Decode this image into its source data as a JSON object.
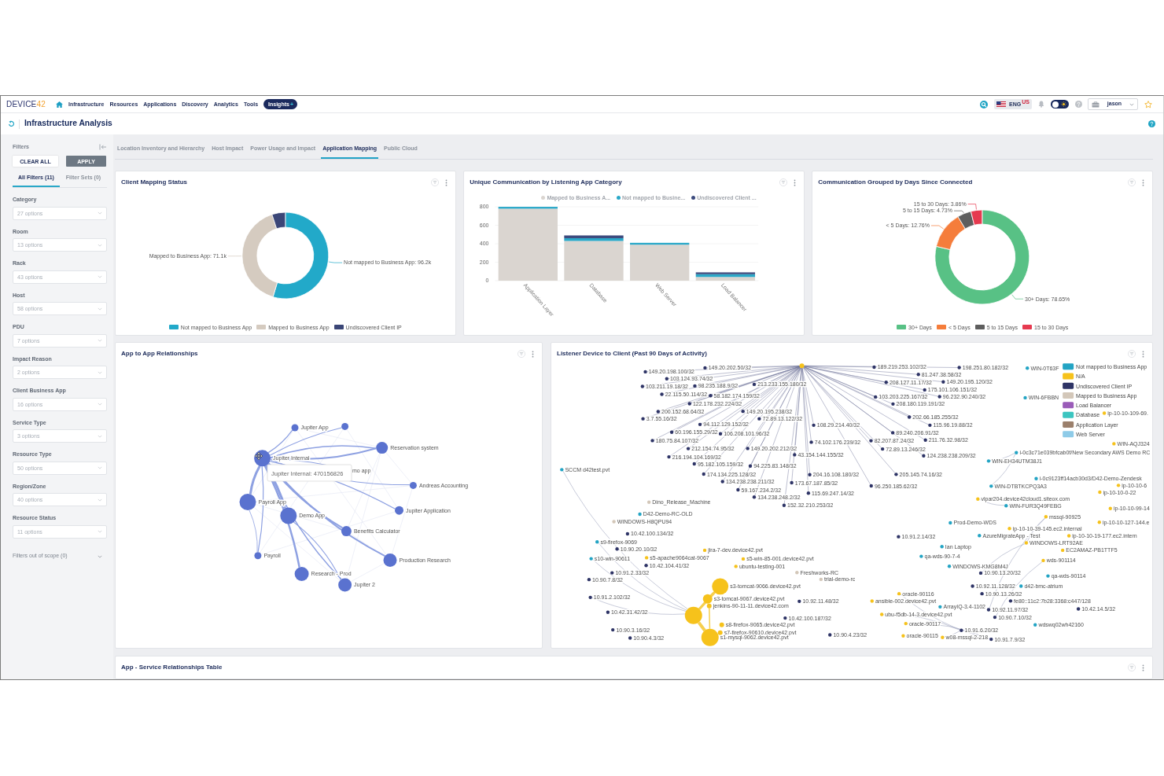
{
  "navbar": {
    "logo": {
      "text": "DEVICE",
      "number": "42"
    },
    "menu": [
      "Infrastructure",
      "Resources",
      "Applications",
      "Discovery",
      "Analytics",
      "Tools"
    ],
    "insights": {
      "label": "Insights",
      "badge": "+"
    },
    "language": {
      "code": "ENG",
      "region": "US"
    },
    "theme_toggle": {
      "on": false
    },
    "user": {
      "name": "jason"
    }
  },
  "page_title": "Infrastructure Analysis",
  "filters": {
    "title": "Filters",
    "clear_button": "CLEAR ALL",
    "apply_button": "APPLY",
    "tabs": [
      {
        "label": "All Filters (11)",
        "selected": true
      },
      {
        "label": "Filter Sets (0)",
        "selected": false
      }
    ],
    "groups": [
      {
        "label": "Category",
        "placeholder": "27 options"
      },
      {
        "label": "Room",
        "placeholder": "13 options"
      },
      {
        "label": "Rack",
        "placeholder": "43 options"
      },
      {
        "label": "Host",
        "placeholder": "58 options"
      },
      {
        "label": "PDU",
        "placeholder": "7 options"
      },
      {
        "label": "Impact Reason",
        "placeholder": "2 options"
      },
      {
        "label": "Client Business App",
        "placeholder": "16 options"
      },
      {
        "label": "Service Type",
        "placeholder": "3 options"
      },
      {
        "label": "Resource Type",
        "placeholder": "50 options"
      },
      {
        "label": "Region/Zone",
        "placeholder": "40 options"
      },
      {
        "label": "Resource Status",
        "placeholder": "11 options"
      }
    ],
    "out_of_scope": "Filters out of scope (0)"
  },
  "tabs": [
    {
      "label": "Location Inventory and Hierarchy",
      "selected": false
    },
    {
      "label": "Host Impact",
      "selected": false
    },
    {
      "label": "Power Usage and Impact",
      "selected": false
    },
    {
      "label": "Application Mapping",
      "selected": true
    },
    {
      "label": "Public Cloud",
      "selected": false
    }
  ],
  "client_mapping": {
    "title": "Client Mapping Status",
    "chart_data": {
      "type": "donut",
      "legend": "bottom",
      "categories": [
        "Not mapped to Business App",
        "Mapped to Business App",
        "Undiscovered Client IP"
      ],
      "values": [
        96.2,
        71.1,
        8.8
      ],
      "colors": [
        "#22a9c9",
        "#d5cbc0",
        "#3b4677"
      ],
      "value_labels": [
        "Not mapped to Business App: 96.2k",
        "Mapped to Business App: 71.1k",
        null
      ]
    }
  },
  "unique_communication": {
    "title": "Unique Communication by Listening App Category",
    "chart_data": {
      "type": "bar",
      "legend": "top",
      "stacked": true,
      "grid": true,
      "categories": [
        "Application Layer",
        "Database",
        "Web Server",
        "Load Balancer"
      ],
      "series": [
        {
          "name": "Mapped to Business A...",
          "color": "#dad5d0",
          "values": [
            780,
            430,
            390,
            40
          ]
        },
        {
          "name": "Not mapped to Busine...",
          "color": "#2aa8c8",
          "values": [
            20,
            30,
            20,
            30
          ]
        },
        {
          "name": "Undiscovered Client ...",
          "color": "#3d4b7e",
          "values": [
            0,
            30,
            0,
            20
          ]
        }
      ],
      "ylim": [
        0,
        800
      ],
      "yticks": [
        0,
        200,
        400,
        600,
        800
      ]
    }
  },
  "days_since_connected": {
    "title": "Communication Grouped by Days Since Connected",
    "chart_data": {
      "type": "donut",
      "legend": "bottom",
      "categories": [
        "30+ Days",
        "< 5 Days",
        "5 to 15 Days",
        "15 to 30 Days"
      ],
      "values": [
        78.65,
        12.76,
        4.73,
        3.86
      ],
      "colors": [
        "#58c185",
        "#f57d3b",
        "#5e5e5e",
        "#e63a50"
      ],
      "value_labels": [
        "30+ Days: 78.65%",
        "< 5 Days: 12.76%",
        "5 to 15 Days: 4.73%",
        "15 to 30 Days: 3.86%"
      ]
    }
  },
  "app_relationships": {
    "title": "App to App Relationships",
    "nodes": [
      {
        "kind": "node",
        "label": "Jupiter Internal"
      },
      {
        "kind": "node",
        "label": "Jupiter App"
      },
      {
        "kind": "node"
      },
      {
        "kind": "node",
        "label": "Reservation system"
      },
      {
        "kind": "covered",
        "label": "mo app"
      },
      {
        "kind": "node",
        "label": "Andreas Accounting"
      },
      {
        "kind": "node",
        "label": "Jupiter Application"
      },
      {
        "kind": "node",
        "label": "Payroll App"
      },
      {
        "kind": "node",
        "label": "Demo App"
      },
      {
        "kind": "node",
        "label": "Benefits Calculator"
      },
      {
        "kind": "node",
        "label": "Payroll"
      },
      {
        "kind": "node",
        "label": "Production Research"
      },
      {
        "kind": "node",
        "label": "Research - Prod"
      },
      {
        "kind": "node",
        "label": "Jupiter 2"
      }
    ],
    "tooltip": "Jupiter Internal: 470156826"
  },
  "listener_graph": {
    "title": "Listener Device to Client (Past 90 Days of Activity)",
    "legend": [
      {
        "label": "Not mapped to Business App",
        "color": "#23a4c4"
      },
      {
        "label": "N/A",
        "color": "#f6c21b"
      },
      {
        "label": "Undiscovered Client IP",
        "color": "#2e3466"
      },
      {
        "label": "Mapped to Business App",
        "color": "#d3c7b9"
      },
      {
        "label": "Load Balancer",
        "color": "#9a5cb8"
      },
      {
        "label": "Database",
        "color": "#3cc5c0"
      },
      {
        "label": "Application Layer",
        "color": "#9b806c"
      },
      {
        "label": "Web Server",
        "color": "#8ecbe8"
      }
    ],
    "nodes": [
      {
        "color": "#f6c21b"
      },
      {
        "label": "149.20.198.100/32",
        "color": "#2e3466"
      },
      {
        "label": "149.20.202.50/32",
        "color": "#2e3466"
      },
      {
        "label": "103.124.93.74/32",
        "color": "#2e3466"
      },
      {
        "label": "103.211.19.18/32",
        "color": "#2e3466"
      },
      {
        "label": "98.235.188.9/32",
        "color": "#2e3466"
      },
      {
        "label": "213.233.155.180/32",
        "color": "#2e3466"
      },
      {
        "label": "22.115.50.114/32",
        "color": "#2e3466"
      },
      {
        "label": "58.182.174.159/32",
        "color": "#2e3466"
      },
      {
        "label": "122.178.232.224/32",
        "color": "#2e3466"
      },
      {
        "label": "200.152.68.64/32",
        "color": "#2e3466"
      },
      {
        "label": "3.7.55.16/32",
        "color": "#2e3466"
      },
      {
        "label": "149.20.195.238/32",
        "color": "#2e3466"
      },
      {
        "label": "72.89.13.122/32",
        "color": "#2e3466"
      },
      {
        "label": "94.112.129.152/32",
        "color": "#2e3466"
      },
      {
        "label": "108.29.214.40/32",
        "color": "#2e3466"
      },
      {
        "label": "60.196.155.29/32",
        "color": "#2e3466"
      },
      {
        "label": "106.208.101.96/32",
        "color": "#2e3466"
      },
      {
        "label": "180.75.84.107/32",
        "color": "#2e3466"
      },
      {
        "label": "212.154.74.95/32",
        "color": "#2e3466"
      },
      {
        "label": "74.102.176.239/32",
        "color": "#2e3466"
      },
      {
        "label": "149.20.202.212/32",
        "color": "#2e3466"
      },
      {
        "label": "216.194.104.169/32",
        "color": "#2e3466"
      },
      {
        "label": "43.154.144.155/32",
        "color": "#2e3466"
      },
      {
        "label": "95.182.105.159/32",
        "color": "#2e3466"
      },
      {
        "label": "94.225.83.148/32",
        "color": "#2e3466"
      },
      {
        "label": "174.134.225.128/32",
        "color": "#2e3466"
      },
      {
        "label": "204.16.108.180/32",
        "color": "#2e3466"
      },
      {
        "label": "134.238.238.211/32",
        "color": "#2e3466"
      },
      {
        "label": "173.67.187.85/32",
        "color": "#2e3466"
      },
      {
        "label": "59.167.234.2/32",
        "color": "#2e3466"
      },
      {
        "label": "134.238.248.2/32",
        "color": "#2e3466"
      },
      {
        "label": "115.69.247.14/32",
        "color": "#2e3466"
      },
      {
        "label": "152.32.210.253/32",
        "color": "#2e3466"
      },
      {
        "label": "189.219.253.102/32",
        "color": "#2e3466"
      },
      {
        "label": "81.247.38.58/32",
        "color": "#2e3466"
      },
      {
        "label": "198.251.80.182/32",
        "color": "#2e3466"
      },
      {
        "label": "208.127.11.17/32",
        "color": "#2e3466"
      },
      {
        "label": "149.20.195.120/32",
        "color": "#2e3466"
      },
      {
        "label": "175.101.106.151/32",
        "color": "#2e3466"
      },
      {
        "label": "103.203.225.167/32",
        "color": "#2e3466"
      },
      {
        "label": "208.180.119.191/32",
        "color": "#2e3466"
      },
      {
        "label": "96.232.90.240/32",
        "color": "#2e3466"
      },
      {
        "label": "202.66.185.255/32",
        "color": "#2e3466"
      },
      {
        "label": "115.96.19.88/32",
        "color": "#2e3466"
      },
      {
        "label": "89.240.206.91/32",
        "color": "#2e3466"
      },
      {
        "label": "82.207.87.24/32",
        "color": "#2e3466"
      },
      {
        "label": "211.76.32.98/32",
        "color": "#2e3466"
      },
      {
        "label": "72.89.13.246/32",
        "color": "#2e3466"
      },
      {
        "label": "124.238.238.209/32",
        "color": "#2e3466"
      },
      {
        "label": "205.145.74.16/32",
        "color": "#2e3466"
      },
      {
        "label": "96.250.185.62/32",
        "color": "#2e3466"
      },
      {
        "label": "SCCM d42test.pvt",
        "color": "#23a4c4"
      },
      {
        "label": "Dino_Release_Machine",
        "color": "#d3c7b9"
      },
      {
        "label": "D42-Demo-RC-OLD",
        "color": "#23a4c4"
      },
      {
        "label": "WINDOWS-H8QPU94",
        "color": "#d3c7b9"
      },
      {
        "label": "10.42.100.134/32",
        "color": "#2e3466"
      },
      {
        "label": "s9-firefox-9069",
        "color": "#23a4c4"
      },
      {
        "label": "10.90.20.10/32",
        "color": "#2e3466"
      },
      {
        "label": "s10-win-90611",
        "color": "#23a4c4"
      },
      {
        "label": "s5-apache9064cat-9067",
        "color": "#f6c21b"
      },
      {
        "label": "jira-7-dev.device42.pvt",
        "color": "#f6c21b"
      },
      {
        "label": "s5-win-85-001.device42.pvt",
        "color": "#f6c21b"
      },
      {
        "label": "ubuntu-testing-001",
        "color": "#f6c21b"
      },
      {
        "label": "10.91.2.33/32",
        "color": "#2e3466"
      },
      {
        "label": "10.42.104.41/32",
        "color": "#2e3466"
      },
      {
        "label": "Freshworks-RC",
        "color": "#d3c7b9"
      },
      {
        "label": "10.90.7.8/32",
        "color": "#2e3466"
      },
      {
        "label": "trial-demo-rc",
        "color": "#d3c7b9"
      },
      {
        "label": "s3-tomcat-9066.device42.pvt",
        "color": "#f6c21b"
      },
      {
        "label": "s3-tomcat-9067.device42.pvt",
        "color": "#f6c21b"
      },
      {
        "label": "jenkins-90-11-11.device42.com",
        "color": "#f6c21b"
      },
      {
        "label": "10.91.2.102/32",
        "color": "#2e3466"
      },
      {
        "label": "10.92.11.48/32",
        "color": "#2e3466"
      },
      {
        "label": "10.42.31.42/32",
        "color": "#2e3466"
      },
      {
        "color": "#f6c21b"
      },
      {
        "label": "s8-firefox-9065.device42.pvt",
        "color": "#f6c21b"
      },
      {
        "label": "s7-firefox-90610.device42.pvt",
        "color": "#f6c21b"
      },
      {
        "label": "s1-mysql-9062.device42.pvt",
        "color": "#f6c21b"
      },
      {
        "label": "10.90.3.16/32",
        "color": "#2e3466"
      },
      {
        "label": "10.90.4.3/32",
        "color": "#2e3466"
      },
      {
        "label": "10.42.100.187/32",
        "color": "#2e3466"
      },
      {
        "label": "10.90.4.23/32",
        "color": "#2e3466"
      },
      {
        "label": "WIN-0T63F",
        "color": "#23a4c4"
      },
      {
        "label": "WIN-6FBBN",
        "color": "#23a4c4"
      },
      {
        "label": "ip-10-10-109-69.",
        "color": "#f6c21b"
      },
      {
        "label": "WIN-AQJ324",
        "color": "#f6c21b"
      },
      {
        "label": "i-0c3c71e039bfcab0f/New Secondary AWS Demo RC",
        "color": "#23a4c4"
      },
      {
        "label": "WIN-EH34UTM38J1",
        "color": "#23a4c4"
      },
      {
        "label": "i-0c9123ff14acb30d3/D42-Demo-Zendesk",
        "color": "#23a4c4"
      },
      {
        "label": "WIN-DTBTKCPQ3A3",
        "color": "#23a4c4"
      },
      {
        "label": "ip-10-10-6",
        "color": "#f6c21b"
      },
      {
        "label": "ip-10-10-0-22",
        "color": "#f6c21b"
      },
      {
        "label": "vlpar204.device42cloud1.siteox.com",
        "color": "#f6c21b"
      },
      {
        "label": "WIN-FUR3Q49FEBG",
        "color": "#23a4c4"
      },
      {
        "label": "ip-10-10-99-14",
        "color": "#f6c21b"
      },
      {
        "label": "mssql-90925",
        "color": "#f6c21b"
      },
      {
        "label": "Prod-Demo-WDS",
        "color": "#23a4c4"
      },
      {
        "label": "ip-10-10-127-144.e",
        "color": "#f6c21b"
      },
      {
        "label": "ip-10-10-39-145.ec2.internal",
        "color": "#f6c21b"
      },
      {
        "label": "ip-10-10-19-177.ec2.intern",
        "color": "#f6c21b"
      },
      {
        "label": "WINDOWS-LRT92AE",
        "color": "#f6c21b"
      },
      {
        "label": "10.91.2.14/32",
        "color": "#2e3466"
      },
      {
        "label": "AzureMigrateApp - Test",
        "color": "#23a4c4"
      },
      {
        "label": "Ian Laptop",
        "color": "#23a4c4"
      },
      {
        "label": "EC2AMAZ-PB1TTF5",
        "color": "#f6c21b"
      },
      {
        "label": "qa-wds-90-7-4",
        "color": "#23a4c4"
      },
      {
        "label": "wds-901114",
        "color": "#f6c21b"
      },
      {
        "label": "WINDOWS-KMG8M4J",
        "color": "#23a4c4"
      },
      {
        "label": "10.90.13.20/32",
        "color": "#2e3466"
      },
      {
        "label": "qa-wds-90114",
        "color": "#23a4c4"
      },
      {
        "label": "10.92.11.128/32",
        "color": "#2e3466"
      },
      {
        "label": "d42-bmc-atrium",
        "color": "#23a4c4"
      },
      {
        "label": "oracle-90116",
        "color": "#f6c21b"
      },
      {
        "label": "10.90.13.26/32",
        "color": "#2e3466"
      },
      {
        "label": "fe80::11c2:7b28:3368:c447/128",
        "color": "#2e3466"
      },
      {
        "label": "ArrayIQ-3.4-1102",
        "color": "#23a4c4"
      },
      {
        "label": "ansible-002.device42.pvt",
        "color": "#f6c21b"
      },
      {
        "label": "10.92.11.97/32",
        "color": "#2e3466"
      },
      {
        "label": "10.42.14.5/32",
        "color": "#2e3466"
      },
      {
        "label": "ubu-f5db-14-3.device42.pvt",
        "color": "#f6c21b"
      },
      {
        "label": "10.90.7.10/32",
        "color": "#2e3466"
      },
      {
        "label": "oracle-90117",
        "color": "#f6c21b"
      },
      {
        "label": "wdswq02wh42160",
        "color": "#23a4c4"
      },
      {
        "label": "10.91.6.20/32",
        "color": "#2e3466"
      },
      {
        "label": "oracle-90115",
        "color": "#f6c21b"
      },
      {
        "label": "w08-mssql-2-218",
        "color": "#f6c21b"
      },
      {
        "label": "10.91.7.9/32",
        "color": "#2e3466"
      }
    ]
  },
  "service_table": {
    "title": "App - Service Relationships Table"
  }
}
